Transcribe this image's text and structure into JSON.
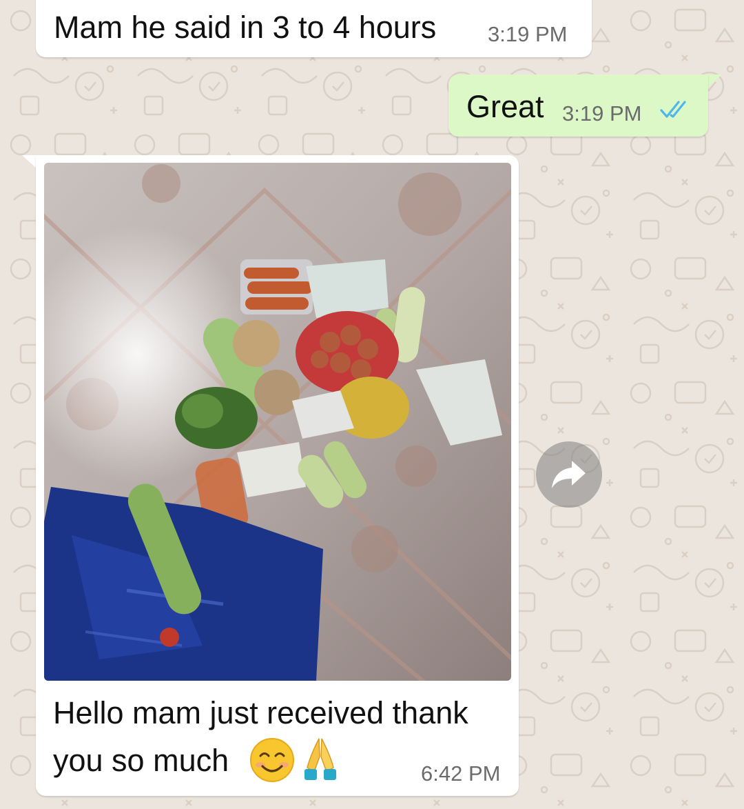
{
  "messages": [
    {
      "direction": "incoming",
      "text": "Mam he said in 3 to 4 hours",
      "time": "3:19 PM"
    },
    {
      "direction": "outgoing",
      "text": "Great",
      "time": "3:19 PM",
      "status": "read-double-tick"
    },
    {
      "direction": "incoming",
      "type": "image",
      "caption_line1": "Hello mam just received thank",
      "caption_line2": "you so much",
      "emojis": [
        "smiling-face-icon",
        "folded-hands-icon"
      ],
      "time": "6:42 PM"
    }
  ],
  "icons": {
    "forward": "forward-icon",
    "read_ticks": "double-check-icon"
  },
  "colors": {
    "wallpaper": "#ece5dd",
    "incoming_bubble": "#ffffff",
    "outgoing_bubble": "#dcf8c6",
    "read_tick": "#4fb6ec",
    "timestamp": "#6b6b6b"
  }
}
